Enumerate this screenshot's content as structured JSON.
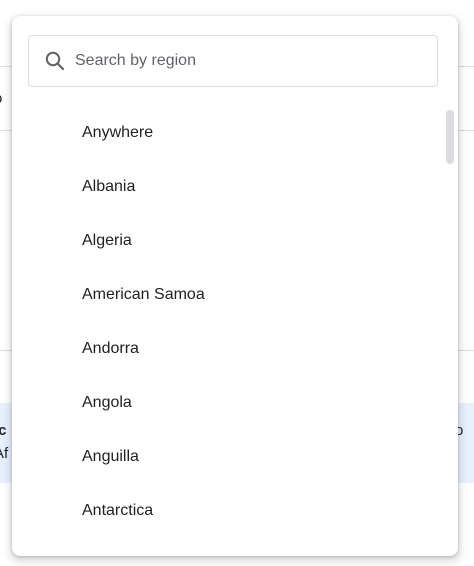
{
  "search": {
    "placeholder": "Search by region",
    "value": ""
  },
  "regions": [
    "Anywhere",
    "Albania",
    "Algeria",
    "American Samoa",
    "Andorra",
    "Angola",
    "Anguilla",
    "Antarctica"
  ],
  "background_fragments": {
    "left_top": "o",
    "left_bold": "ic",
    "left_second": "Af",
    "right": "o"
  },
  "colors": {
    "text": "#202124",
    "placeholder": "#5f6368",
    "border": "#dadce0",
    "highlight_panel": "#e8f0fe"
  }
}
